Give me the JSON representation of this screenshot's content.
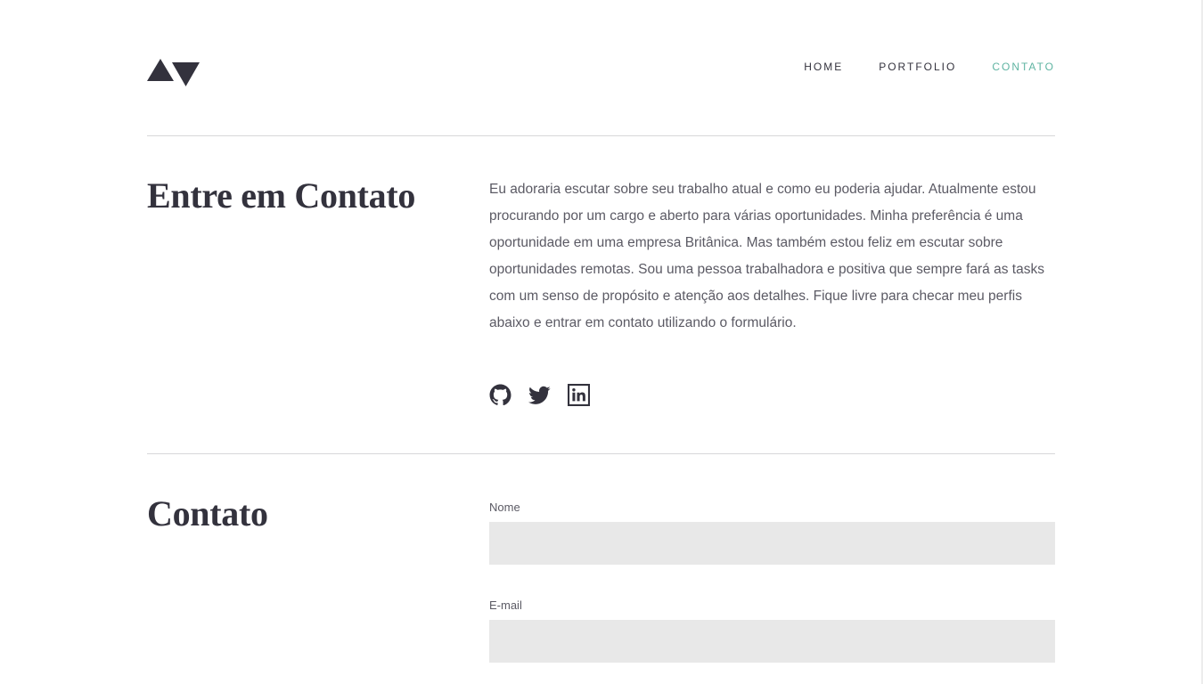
{
  "header": {
    "nav": [
      {
        "label": "HOME",
        "active": false
      },
      {
        "label": "PORTFOLIO",
        "active": false
      },
      {
        "label": "CONTATO",
        "active": true
      }
    ]
  },
  "intro": {
    "title": "Entre em Contato",
    "text": "Eu adoraria escutar sobre seu trabalho atual e como eu poderia ajudar. Atualmente estou procurando por um cargo e aberto para várias oportunidades. Minha preferência é uma oportunidade em uma empresa Britânica. Mas também estou feliz em escutar sobre oportunidades remotas. Sou uma pessoa trabalhadora e positiva que sempre fará as tasks com um senso de propósito e atenção aos detalhes. Fique livre para checar meu perfis abaixo e entrar em contato utilizando o formulário.",
    "socials": [
      "github-icon",
      "twitter-icon",
      "linkedin-icon"
    ]
  },
  "contact": {
    "title": "Contato",
    "fields": [
      {
        "label": "Nome",
        "value": "",
        "placeholder": ""
      },
      {
        "label": "E-mail",
        "value": "",
        "placeholder": ""
      }
    ]
  },
  "colors": {
    "text": "#33323d",
    "accent": "#5fb4a2",
    "input_bg": "#e8e8e8",
    "divider": "#d7d7d9"
  }
}
